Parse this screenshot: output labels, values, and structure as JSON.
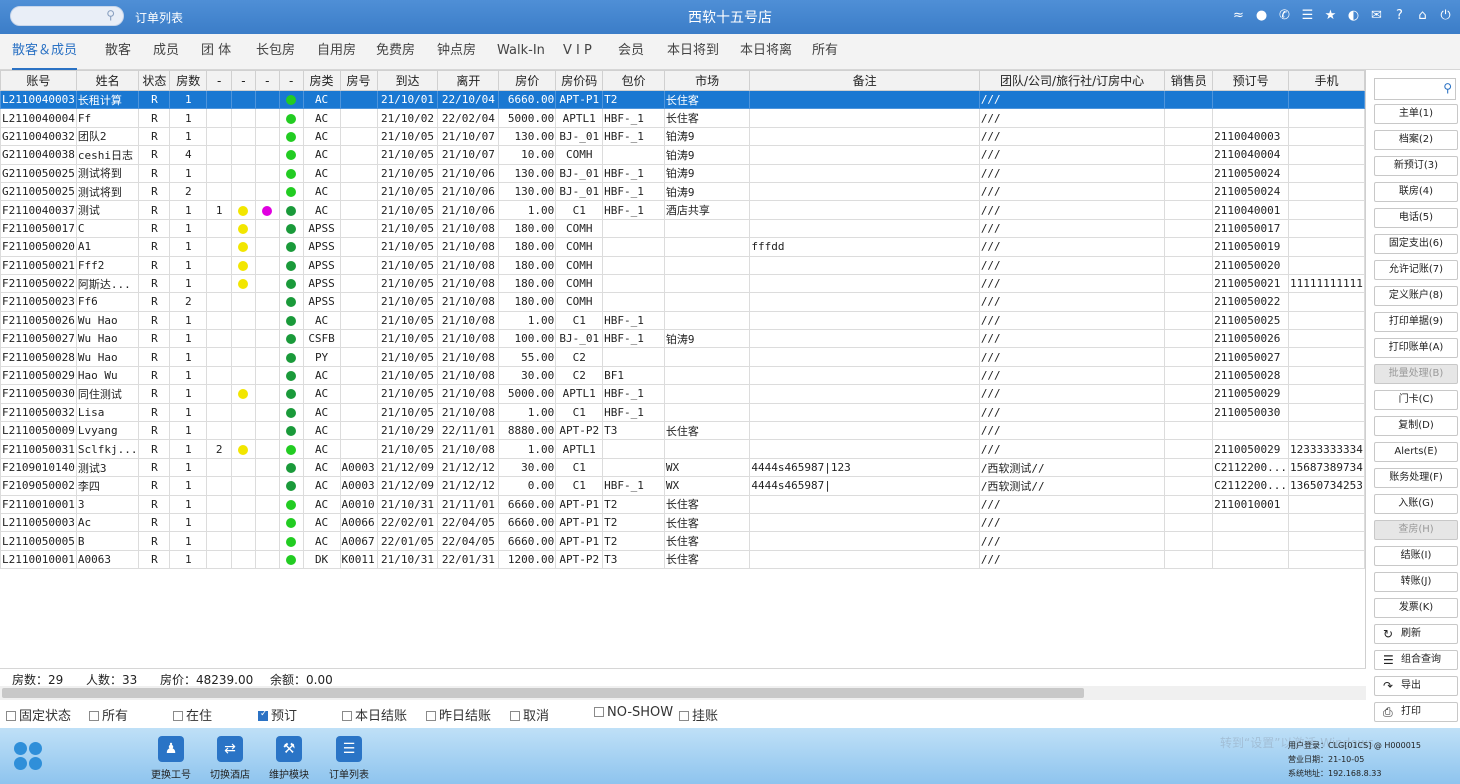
{
  "titlebar": {
    "window_title": "订单列表",
    "hotel_name": "西软十五号店",
    "icons": [
      "wifi-icon",
      "chat-icon",
      "phone-icon",
      "menu-icon",
      "star-icon",
      "moon-icon",
      "mail-icon",
      "help-icon",
      "home-icon",
      "power-icon"
    ]
  },
  "tabs": [
    "散客＆成员",
    "散客",
    "成员",
    "团 体",
    "长包房",
    "自用房",
    "免费房",
    "钟点房",
    "Walk-In",
    "V I P",
    "会员",
    "本日将到",
    "本日将离",
    "所有"
  ],
  "table": {
    "headers": [
      "账号",
      "姓名",
      "状态",
      "房数",
      "-",
      "-",
      "-",
      "-",
      "房类",
      "房号",
      "到达",
      "离开",
      "房价",
      "房价码",
      "包价",
      "市场",
      "备注",
      "团队/公司/旅行社/订房中心",
      "销售员",
      "预订号",
      "手机"
    ],
    "rows": [
      [
        "L2110040003",
        "长租计算",
        "R",
        "1",
        "",
        "",
        "",
        "green",
        "AC",
        "",
        "21/10/01",
        "22/10/04",
        "6660.00",
        "APT-P1",
        "T2",
        "长住客",
        "",
        "///",
        "",
        "",
        ""
      ],
      [
        "L2110040004",
        "Ff",
        "R",
        "1",
        "",
        "",
        "",
        "green",
        "AC",
        "",
        "21/10/02",
        "22/02/04",
        "5000.00",
        "APTL1",
        "HBF-_1",
        "长住客",
        "",
        "///",
        "",
        "",
        ""
      ],
      [
        "G2110040032",
        "团队2",
        "R",
        "1",
        "",
        "",
        "",
        "green",
        "AC",
        "",
        "21/10/05",
        "21/10/07",
        "130.00",
        "BJ-_01",
        "HBF-_1",
        "铂涛9",
        "",
        "///",
        "",
        "2110040003",
        ""
      ],
      [
        "G2110040038",
        "ceshi日志",
        "R",
        "4",
        "",
        "",
        "",
        "green",
        "AC",
        "",
        "21/10/05",
        "21/10/07",
        "10.00",
        "COMH",
        "",
        "铂涛9",
        "",
        "///",
        "",
        "2110040004",
        ""
      ],
      [
        "G2110050025",
        "测试将到",
        "R",
        "1",
        "",
        "",
        "",
        "green",
        "AC",
        "",
        "21/10/05",
        "21/10/06",
        "130.00",
        "BJ-_01",
        "HBF-_1",
        "铂涛9",
        "",
        "///",
        "",
        "2110050024",
        ""
      ],
      [
        "G2110050025",
        "测试将到",
        "R",
        "2",
        "",
        "",
        "",
        "green",
        "AC",
        "",
        "21/10/05",
        "21/10/06",
        "130.00",
        "BJ-_01",
        "HBF-_1",
        "铂涛9",
        "",
        "///",
        "",
        "2110050024",
        ""
      ],
      [
        "F2110040037",
        "测试",
        "R",
        "1",
        "1",
        "yellow",
        "magenta",
        "dkgreen",
        "AC",
        "",
        "21/10/05",
        "21/10/06",
        "1.00",
        "C1",
        "HBF-_1",
        "酒店共享",
        "",
        "///",
        "",
        "2110040001",
        ""
      ],
      [
        "F2110050017",
        "C",
        "R",
        "1",
        "",
        "yellow",
        "",
        "dkgreen",
        "APSS",
        "",
        "21/10/05",
        "21/10/08",
        "180.00",
        "COMH",
        "",
        "",
        "",
        "///",
        "",
        "2110050017",
        ""
      ],
      [
        "F2110050020",
        "A1",
        "R",
        "1",
        "",
        "yellow",
        "",
        "dkgreen",
        "APSS",
        "",
        "21/10/05",
        "21/10/08",
        "180.00",
        "COMH",
        "",
        "",
        "fffdd",
        "///",
        "",
        "2110050019",
        ""
      ],
      [
        "F2110050021",
        "Fff2",
        "R",
        "1",
        "",
        "yellow",
        "",
        "dkgreen",
        "APSS",
        "",
        "21/10/05",
        "21/10/08",
        "180.00",
        "COMH",
        "",
        "",
        "",
        "///",
        "",
        "2110050020",
        ""
      ],
      [
        "F2110050022",
        "阿斯达...",
        "R",
        "1",
        "",
        "yellow",
        "",
        "dkgreen",
        "APSS",
        "",
        "21/10/05",
        "21/10/08",
        "180.00",
        "COMH",
        "",
        "",
        "",
        "///",
        "",
        "2110050021",
        "11111111111"
      ],
      [
        "F2110050023",
        "Ff6",
        "R",
        "2",
        "",
        "",
        "",
        "dkgreen",
        "APSS",
        "",
        "21/10/05",
        "21/10/08",
        "180.00",
        "COMH",
        "",
        "",
        "",
        "///",
        "",
        "2110050022",
        ""
      ],
      [
        "F2110050026",
        "Wu Hao",
        "R",
        "1",
        "",
        "",
        "",
        "dkgreen",
        "AC",
        "",
        "21/10/05",
        "21/10/08",
        "1.00",
        "C1",
        "HBF-_1",
        "",
        "",
        "///",
        "",
        "2110050025",
        ""
      ],
      [
        "F2110050027",
        "Wu Hao",
        "R",
        "1",
        "",
        "",
        "",
        "dkgreen",
        "CSFB",
        "",
        "21/10/05",
        "21/10/08",
        "100.00",
        "BJ-_01",
        "HBF-_1",
        "铂涛9",
        "",
        "///",
        "",
        "2110050026",
        ""
      ],
      [
        "F2110050028",
        "Wu Hao",
        "R",
        "1",
        "",
        "",
        "",
        "dkgreen",
        "PY",
        "",
        "21/10/05",
        "21/10/08",
        "55.00",
        "C2",
        "",
        "",
        "",
        "///",
        "",
        "2110050027",
        ""
      ],
      [
        "F2110050029",
        "Hao Wu",
        "R",
        "1",
        "",
        "",
        "",
        "dkgreen",
        "AC",
        "",
        "21/10/05",
        "21/10/08",
        "30.00",
        "C2",
        "BF1",
        "",
        "",
        "///",
        "",
        "2110050028",
        ""
      ],
      [
        "F2110050030",
        "同住测试",
        "R",
        "1",
        "",
        "yellow",
        "",
        "dkgreen",
        "AC",
        "",
        "21/10/05",
        "21/10/08",
        "5000.00",
        "APTL1",
        "HBF-_1",
        "",
        "",
        "///",
        "",
        "2110050029",
        ""
      ],
      [
        "F2110050032",
        "Lisa",
        "R",
        "1",
        "",
        "",
        "",
        "dkgreen",
        "AC",
        "",
        "21/10/05",
        "21/10/08",
        "1.00",
        "C1",
        "HBF-_1",
        "",
        "",
        "///",
        "",
        "2110050030",
        ""
      ],
      [
        "L2110050009",
        "Lvyang",
        "R",
        "1",
        "",
        "",
        "",
        "dkgreen",
        "AC",
        "",
        "21/10/29",
        "22/11/01",
        "8880.00",
        "APT-P2",
        "T3",
        "长住客",
        "",
        "///",
        "",
        "",
        ""
      ],
      [
        "F2110050031",
        "Sclfkj...",
        "R",
        "1",
        "2",
        "yellow",
        "",
        "green",
        "AC",
        "",
        "21/10/05",
        "21/10/08",
        "1.00",
        "APTL1",
        "",
        "",
        "",
        "///",
        "",
        "2110050029",
        "12333333334"
      ],
      [
        "F2109010140",
        "测试3",
        "R",
        "1",
        "",
        "",
        "",
        "dkgreen",
        "AC",
        "A0003",
        "21/12/09",
        "21/12/12",
        "30.00",
        "C1",
        "",
        "WX",
        "4444s465987|123",
        "/西软测试//",
        "",
        "C2112200...",
        "15687389734"
      ],
      [
        "F2109050002",
        "李四",
        "R",
        "1",
        "",
        "",
        "",
        "dkgreen",
        "AC",
        "A0003",
        "21/12/09",
        "21/12/12",
        "0.00",
        "C1",
        "HBF-_1",
        "WX",
        "4444s465987|",
        "/西软测试//",
        "",
        "C2112200...",
        "13650734253"
      ],
      [
        "F2110010001",
        "3",
        "R",
        "1",
        "",
        "",
        "",
        "green",
        "AC",
        "A0010",
        "21/10/31",
        "21/11/01",
        "6660.00",
        "APT-P1",
        "T2",
        "长住客",
        "",
        "///",
        "",
        "2110010001",
        ""
      ],
      [
        "L2110050003",
        "Ac",
        "R",
        "1",
        "",
        "",
        "",
        "green",
        "AC",
        "A0066",
        "22/02/01",
        "22/04/05",
        "6660.00",
        "APT-P1",
        "T2",
        "长住客",
        "",
        "///",
        "",
        "",
        ""
      ],
      [
        "L2110050005",
        "B",
        "R",
        "1",
        "",
        "",
        "",
        "green",
        "AC",
        "A0067",
        "22/01/05",
        "22/04/05",
        "6660.00",
        "APT-P1",
        "T2",
        "长住客",
        "",
        "///",
        "",
        "",
        ""
      ],
      [
        "L2110010001",
        "A0063",
        "R",
        "1",
        "",
        "",
        "",
        "green",
        "DK",
        "K0011",
        "21/10/31",
        "22/01/31",
        "1200.00",
        "APT-P2",
        "T3",
        "长住客",
        "",
        "///",
        "",
        "",
        ""
      ]
    ]
  },
  "summary": {
    "rooms": "房数：29",
    "people": "人数：33",
    "rate": "房价：48239.00",
    "balance": "余额：0.00"
  },
  "filters": [
    {
      "label": "固定状态",
      "checked": false
    },
    {
      "label": "所有",
      "checked": false
    },
    {
      "label": "在住",
      "checked": false
    },
    {
      "label": "预订",
      "checked": true
    },
    {
      "label": "本日结账",
      "checked": false
    },
    {
      "label": "昨日结账",
      "checked": false
    },
    {
      "label": "取消",
      "checked": false
    },
    {
      "label": "NO-SHOW",
      "checked": false
    },
    {
      "label": "挂账",
      "checked": false
    }
  ],
  "sidebar": {
    "buttons": [
      {
        "label": "主单(1)",
        "disabled": false
      },
      {
        "label": "档案(2)",
        "disabled": false
      },
      {
        "label": "新预订(3)",
        "disabled": false
      },
      {
        "label": "联房(4)",
        "disabled": false
      },
      {
        "label": "电话(5)",
        "disabled": false
      },
      {
        "label": "固定支出(6)",
        "disabled": false
      },
      {
        "label": "允许记账(7)",
        "disabled": false
      },
      {
        "label": "定义账户(8)",
        "disabled": false
      },
      {
        "label": "打印单据(9)",
        "disabled": false
      },
      {
        "label": "打印账单(A)",
        "disabled": false
      },
      {
        "label": "批量处理(B)",
        "disabled": true
      },
      {
        "label": "门卡(C)",
        "disabled": false
      },
      {
        "label": "复制(D)",
        "disabled": false
      },
      {
        "label": "Alerts(E)",
        "disabled": false
      },
      {
        "label": "账务处理(F)",
        "disabled": false
      },
      {
        "label": "入账(G)",
        "disabled": false
      },
      {
        "label": "查房(H)",
        "disabled": true
      },
      {
        "label": "结账(I)",
        "disabled": false
      },
      {
        "label": "转账(J)",
        "disabled": false
      },
      {
        "label": "发票(K)",
        "disabled": false
      }
    ],
    "icon_buttons": [
      {
        "label": "刷新",
        "icon": "refresh-icon"
      },
      {
        "label": "组合查询",
        "icon": "list-icon"
      },
      {
        "label": "导出",
        "icon": "export-icon"
      },
      {
        "label": "打印",
        "icon": "print-icon"
      }
    ]
  },
  "bottombar": {
    "tools": [
      {
        "label": "更换工号",
        "icon": "user-icon"
      },
      {
        "label": "切换酒店",
        "icon": "switch-icon"
      },
      {
        "label": "维护模块",
        "icon": "wrench-icon"
      },
      {
        "label": "订单列表",
        "icon": "list-icon"
      }
    ],
    "watermark": "转到“设置”以激活 Windows。",
    "user": "用户登录：CLG[01CS] @ H000015",
    "business_date": "营业日期：21-10-05",
    "system_address": "系统地址：192.168.8.33"
  },
  "colors": {
    "accent": "#2b72c4",
    "selected_row": "#1a78d2",
    "dot_green": "#22cc22",
    "dot_darkgreen": "#1a9a3a",
    "dot_yellow": "#f2e600",
    "dot_magenta": "#e000e0",
    "alert_red": "#e02020"
  }
}
